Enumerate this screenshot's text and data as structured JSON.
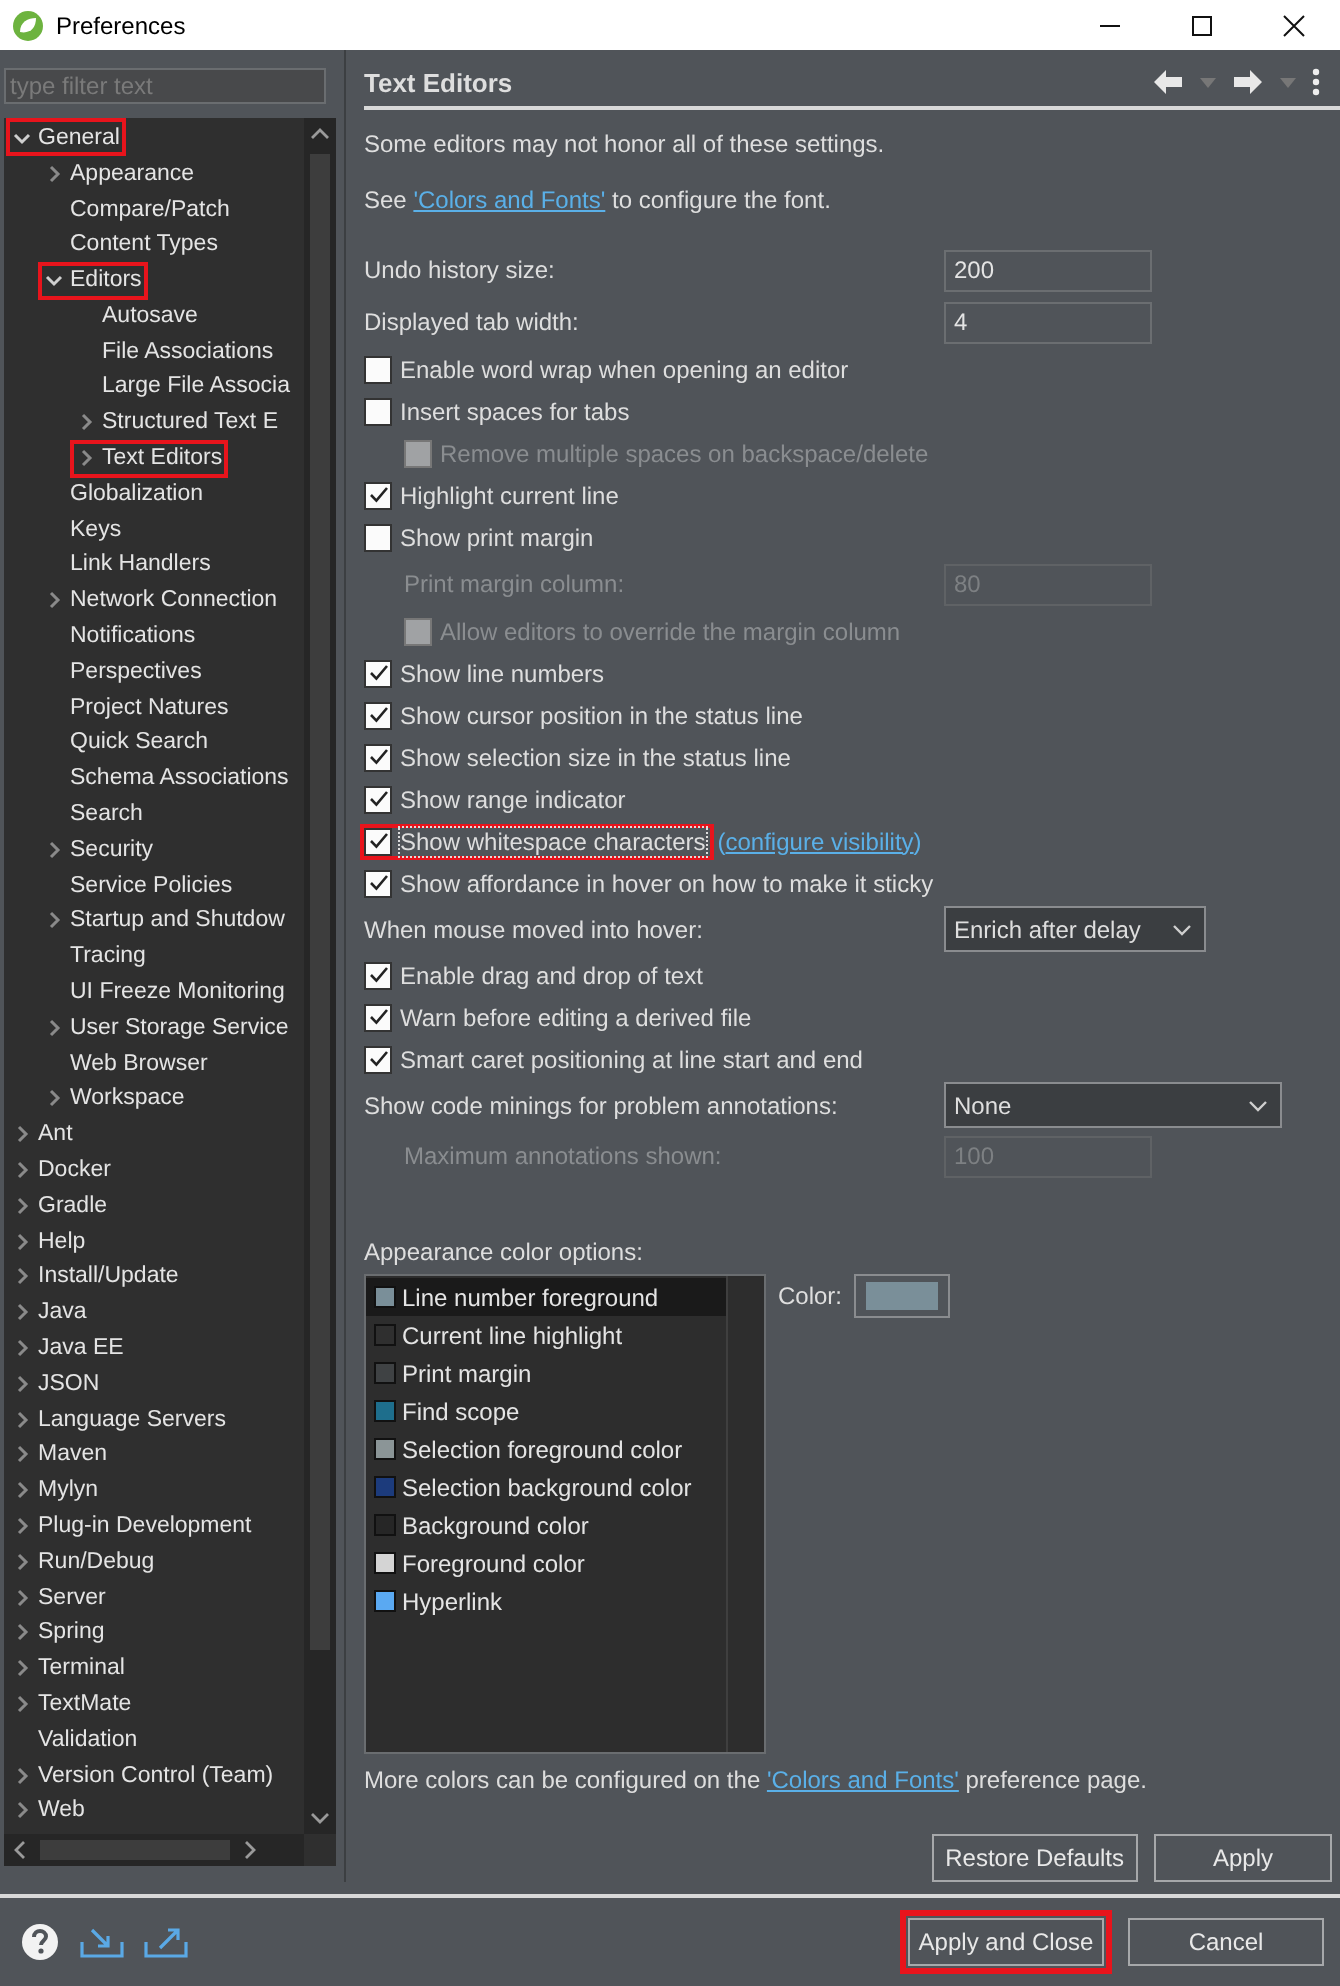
{
  "window": {
    "title": "Preferences"
  },
  "filter": {
    "placeholder": "type filter text"
  },
  "tree": [
    {
      "label": "General",
      "kind": "branch",
      "expanded": true,
      "highlighted": true,
      "children": [
        {
          "label": "Appearance",
          "kind": "branch",
          "expanded": false,
          "highlighted": false
        },
        {
          "label": "Compare/Patch",
          "kind": "leaf",
          "highlighted": false
        },
        {
          "label": "Content Types",
          "kind": "leaf",
          "highlighted": false
        },
        {
          "label": "Editors",
          "kind": "branch",
          "expanded": true,
          "highlighted": true,
          "children": [
            {
              "label": "Autosave",
              "kind": "leaf",
              "highlighted": false
            },
            {
              "label": "File Associations",
              "kind": "leaf",
              "highlighted": false
            },
            {
              "label": "Large File Associa",
              "kind": "leaf",
              "highlighted": false
            },
            {
              "label": "Structured Text E",
              "kind": "branch",
              "expanded": false,
              "highlighted": false
            },
            {
              "label": "Text Editors",
              "kind": "branch",
              "expanded": false,
              "highlighted": true
            }
          ]
        },
        {
          "label": "Globalization",
          "kind": "leaf",
          "highlighted": false
        },
        {
          "label": "Keys",
          "kind": "leaf",
          "highlighted": false
        },
        {
          "label": "Link Handlers",
          "kind": "leaf",
          "highlighted": false
        },
        {
          "label": "Network Connection",
          "kind": "branch",
          "expanded": false,
          "highlighted": false
        },
        {
          "label": "Notifications",
          "kind": "leaf",
          "highlighted": false
        },
        {
          "label": "Perspectives",
          "kind": "leaf",
          "highlighted": false
        },
        {
          "label": "Project Natures",
          "kind": "leaf",
          "highlighted": false
        },
        {
          "label": "Quick Search",
          "kind": "leaf",
          "highlighted": false
        },
        {
          "label": "Schema Associations",
          "kind": "leaf",
          "highlighted": false
        },
        {
          "label": "Search",
          "kind": "leaf",
          "highlighted": false
        },
        {
          "label": "Security",
          "kind": "branch",
          "expanded": false,
          "highlighted": false
        },
        {
          "label": "Service Policies",
          "kind": "leaf",
          "highlighted": false
        },
        {
          "label": "Startup and Shutdow",
          "kind": "branch",
          "expanded": false,
          "highlighted": false
        },
        {
          "label": "Tracing",
          "kind": "leaf",
          "highlighted": false
        },
        {
          "label": "UI Freeze Monitoring",
          "kind": "leaf",
          "highlighted": false
        },
        {
          "label": "User Storage Service",
          "kind": "branch",
          "expanded": false,
          "highlighted": false
        },
        {
          "label": "Web Browser",
          "kind": "leaf",
          "highlighted": false
        },
        {
          "label": "Workspace",
          "kind": "branch",
          "expanded": false,
          "highlighted": false
        }
      ]
    },
    {
      "label": "Ant",
      "kind": "branch",
      "expanded": false,
      "highlighted": false
    },
    {
      "label": "Docker",
      "kind": "branch",
      "expanded": false,
      "highlighted": false
    },
    {
      "label": "Gradle",
      "kind": "branch",
      "expanded": false,
      "highlighted": false
    },
    {
      "label": "Help",
      "kind": "branch",
      "expanded": false,
      "highlighted": false
    },
    {
      "label": "Install/Update",
      "kind": "branch",
      "expanded": false,
      "highlighted": false
    },
    {
      "label": "Java",
      "kind": "branch",
      "expanded": false,
      "highlighted": false
    },
    {
      "label": "Java EE",
      "kind": "branch",
      "expanded": false,
      "highlighted": false
    },
    {
      "label": "JSON",
      "kind": "branch",
      "expanded": false,
      "highlighted": false
    },
    {
      "label": "Language Servers",
      "kind": "branch",
      "expanded": false,
      "highlighted": false
    },
    {
      "label": "Maven",
      "kind": "branch",
      "expanded": false,
      "highlighted": false
    },
    {
      "label": "Mylyn",
      "kind": "branch",
      "expanded": false,
      "highlighted": false
    },
    {
      "label": "Plug-in Development",
      "kind": "branch",
      "expanded": false,
      "highlighted": false
    },
    {
      "label": "Run/Debug",
      "kind": "branch",
      "expanded": false,
      "highlighted": false
    },
    {
      "label": "Server",
      "kind": "branch",
      "expanded": false,
      "highlighted": false
    },
    {
      "label": "Spring",
      "kind": "branch",
      "expanded": false,
      "highlighted": false
    },
    {
      "label": "Terminal",
      "kind": "branch",
      "expanded": false,
      "highlighted": false
    },
    {
      "label": "TextMate",
      "kind": "branch",
      "expanded": false,
      "highlighted": false
    },
    {
      "label": "Validation",
      "kind": "leaf",
      "highlighted": false
    },
    {
      "label": "Version Control (Team)",
      "kind": "branch",
      "expanded": false,
      "highlighted": false
    },
    {
      "label": "Web",
      "kind": "branch",
      "expanded": false,
      "highlighted": false
    }
  ],
  "page": {
    "title": "Text Editors",
    "intro": [
      {
        "kind": "text",
        "text": "Some editors may not honor all of these settings."
      },
      {
        "kind": "link",
        "before": "See ",
        "link": "'Colors and Fonts'",
        "after": " to configure the font."
      }
    ],
    "settings": [
      {
        "kind": "field",
        "label": "Undo history size:",
        "value": "200",
        "disabled": false
      },
      {
        "kind": "field",
        "label": "Displayed tab width:",
        "value": "4",
        "disabled": false
      },
      {
        "kind": "checkbox",
        "label": "Enable word wrap when opening an editor",
        "checked": false,
        "disabled": false,
        "highlighted": false
      },
      {
        "kind": "checkbox",
        "label": "Insert spaces for tabs",
        "checked": false,
        "disabled": false,
        "highlighted": false,
        "children": [
          {
            "kind": "checkbox",
            "label": "Remove multiple spaces on backspace/delete",
            "checked": false,
            "disabled": true,
            "highlighted": false
          }
        ]
      },
      {
        "kind": "checkbox",
        "label": "Highlight current line",
        "checked": true,
        "disabled": false,
        "highlighted": false
      },
      {
        "kind": "checkbox",
        "label": "Show print margin",
        "checked": false,
        "disabled": false,
        "highlighted": false,
        "children": [
          {
            "kind": "field",
            "label": "Print margin column:",
            "value": "80",
            "disabled": true
          },
          {
            "kind": "checkbox",
            "label": "Allow editors to override the margin column",
            "checked": false,
            "disabled": true,
            "highlighted": false
          }
        ]
      },
      {
        "kind": "checkbox",
        "label": "Show line numbers",
        "checked": true,
        "disabled": false,
        "highlighted": false
      },
      {
        "kind": "checkbox",
        "label": "Show cursor position in the status line",
        "checked": true,
        "disabled": false,
        "highlighted": false
      },
      {
        "kind": "checkbox",
        "label": "Show selection size in the status line",
        "checked": true,
        "disabled": false,
        "highlighted": false
      },
      {
        "kind": "checkbox",
        "label": "Show range indicator",
        "checked": true,
        "disabled": false,
        "highlighted": false
      },
      {
        "kind": "checkbox",
        "label": "Show whitespace characters",
        "checked": true,
        "disabled": false,
        "highlighted": true,
        "paren_open": "(",
        "link": "configure visibility",
        "paren_close": ")"
      },
      {
        "kind": "checkbox",
        "label": "Show affordance in hover on how to make it sticky",
        "checked": true,
        "disabled": false,
        "highlighted": false
      },
      {
        "kind": "combo",
        "label": "When mouse moved into hover:",
        "value": "Enrich after delay",
        "wide": false
      },
      {
        "kind": "checkbox",
        "label": "Enable drag and drop of text",
        "checked": true,
        "disabled": false,
        "highlighted": false
      },
      {
        "kind": "checkbox",
        "label": "Warn before editing a derived file",
        "checked": true,
        "disabled": false,
        "highlighted": false
      },
      {
        "kind": "checkbox",
        "label": "Smart caret positioning at line start and end",
        "checked": true,
        "disabled": false,
        "highlighted": false
      },
      {
        "kind": "combo",
        "label": "Show code minings for problem annotations:",
        "value": "None",
        "wide": true,
        "children": [
          {
            "kind": "field",
            "label": "Maximum annotations shown:",
            "value": "100",
            "disabled": true
          }
        ]
      }
    ],
    "appearance": {
      "label": "Appearance color options:",
      "color_label": "Color:",
      "items": [
        {
          "label": "Line number foreground",
          "color": "#7a8f99",
          "selected": true
        },
        {
          "label": "Current line highlight",
          "color": "#2f2f2f",
          "selected": false
        },
        {
          "label": "Print margin",
          "color": "#3f4244",
          "selected": false
        },
        {
          "label": "Find scope",
          "color": "#1e6e8c",
          "selected": false
        },
        {
          "label": "Selection foreground color",
          "color": "#8b9597",
          "selected": false
        },
        {
          "label": "Selection background color",
          "color": "#1c3b7c",
          "selected": false
        },
        {
          "label": "Background color",
          "color": "#262626",
          "selected": false
        },
        {
          "label": "Foreground color",
          "color": "#d4d4d4",
          "selected": false
        },
        {
          "label": "Hyperlink",
          "color": "#5aa9f2",
          "selected": false
        }
      ]
    },
    "footer": {
      "before": "More colors can be configured on the ",
      "link": "'Colors and Fonts'",
      "after": " preference page."
    },
    "buttons": [
      {
        "label": "Restore Defaults"
      },
      {
        "label": "Apply"
      }
    ]
  },
  "dialog_buttons": [
    {
      "label": "Apply and Close",
      "highlighted": true
    },
    {
      "label": "Cancel",
      "highlighted": false
    }
  ]
}
